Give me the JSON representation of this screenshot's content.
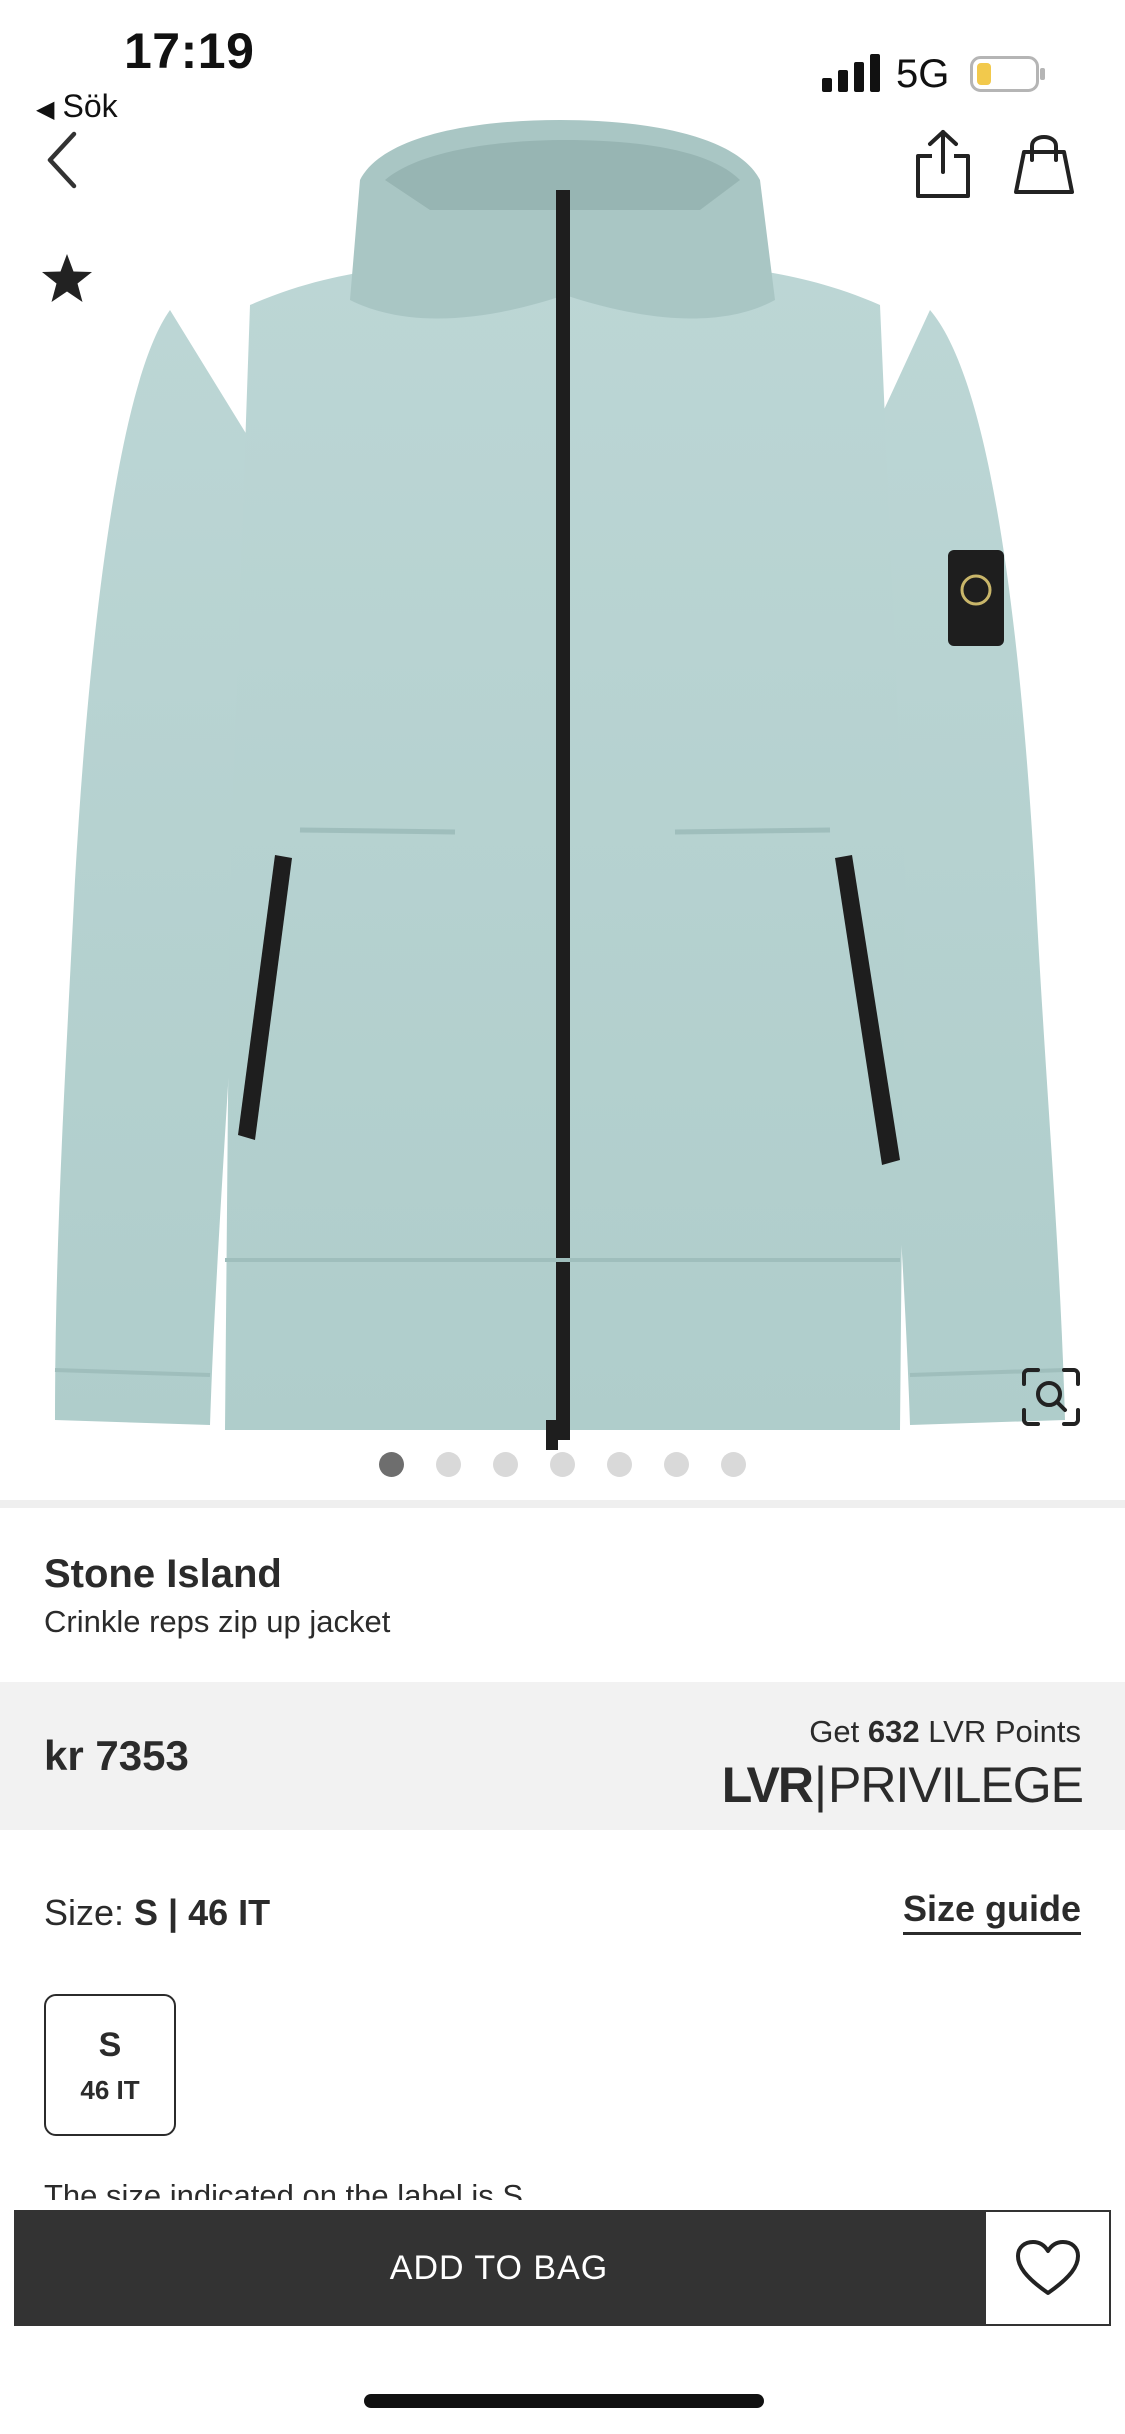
{
  "status_bar": {
    "time": "17:19",
    "back_app_label": "Sök",
    "network": "5G",
    "signal_icon": "signal-bars-icon",
    "battery_icon": "battery-low-icon",
    "battery_color": "#f2c94c"
  },
  "header": {
    "back_icon": "chevron-left-icon",
    "share_icon": "share-icon",
    "bag_icon": "shopping-bag-icon",
    "favorite_icon": "star-icon"
  },
  "gallery": {
    "image_description": "jacket-product-image",
    "jacket_color": "#b7d3d2",
    "zoom_icon": "search-zoom-icon",
    "dot_count": 7,
    "active_dot": 0
  },
  "product": {
    "brand": "Stone Island",
    "name": "Crinkle reps zip up jacket"
  },
  "price_band": {
    "price": "kr 7353",
    "points_prefix": "Get ",
    "points_value": "632",
    "points_suffix": " LVR Points",
    "logo_lvr": "LVR",
    "logo_sep": "|",
    "logo_privilege": "PRIVILEGE"
  },
  "size": {
    "label": "Size: ",
    "selected": "S | 46 IT",
    "guide_label": "Size guide",
    "options": [
      {
        "size": "S",
        "alt": "46 IT"
      }
    ],
    "note": "The size indicated on the label is S"
  },
  "actions": {
    "add_to_bag": "ADD TO BAG",
    "wishlist_icon": "heart-icon"
  }
}
